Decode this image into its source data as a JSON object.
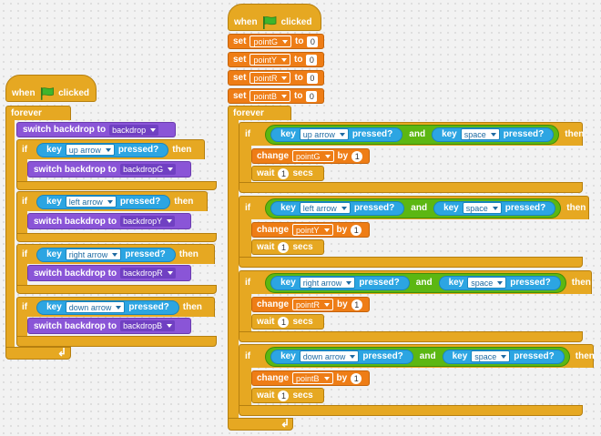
{
  "labels": {
    "when": "when",
    "clicked": "clicked",
    "forever": "forever",
    "switch_backdrop_to": "switch backdrop to",
    "if": "if",
    "then": "then",
    "key": "key",
    "pressed": "pressed?",
    "and": "and",
    "set": "set",
    "to": "to",
    "change": "change",
    "by": "by",
    "wait": "wait",
    "secs": "secs"
  },
  "icons": {
    "flag": "green-flag-icon",
    "loop": "loop-arrow-icon"
  },
  "left_script": {
    "initial_backdrop": "backdrop",
    "branches": [
      {
        "key": "up arrow",
        "backdrop": "backdropG"
      },
      {
        "key": "left arrow",
        "backdrop": "backdropY"
      },
      {
        "key": "right arrow",
        "backdrop": "backdropR"
      },
      {
        "key": "down arrow",
        "backdrop": "backdropB"
      }
    ]
  },
  "right_script": {
    "sets": [
      {
        "var": "pointG",
        "value": "0"
      },
      {
        "var": "pointY",
        "value": "0"
      },
      {
        "var": "pointR",
        "value": "0"
      },
      {
        "var": "pointB",
        "value": "0"
      }
    ],
    "branches": [
      {
        "key": "up arrow",
        "key2": "space",
        "var": "pointG",
        "by": "1",
        "wait": "1"
      },
      {
        "key": "left arrow",
        "key2": "space",
        "var": "pointY",
        "by": "1",
        "wait": "1"
      },
      {
        "key": "right arrow",
        "key2": "space",
        "var": "pointR",
        "by": "1",
        "wait": "1"
      },
      {
        "key": "down arrow",
        "key2": "space",
        "var": "pointB",
        "by": "1",
        "wait": "1"
      }
    ]
  },
  "colors": {
    "control": "#e6a822",
    "looks": "#8a55d7",
    "data": "#ee7d16",
    "sensing": "#2ca5e2",
    "operators": "#5cb712",
    "flag": "#3fb52c"
  }
}
